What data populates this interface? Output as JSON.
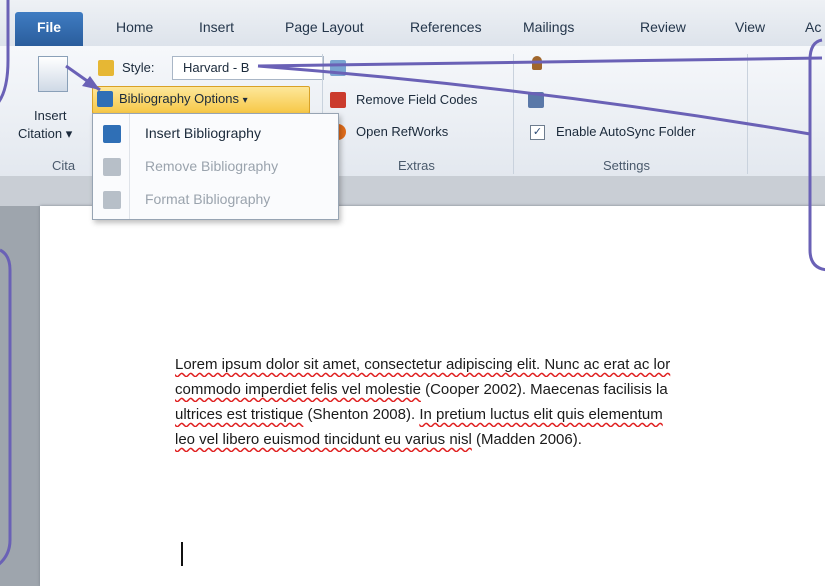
{
  "tabs": [
    {
      "label": "File"
    },
    {
      "label": "Home"
    },
    {
      "label": "Insert"
    },
    {
      "label": "Page Layout"
    },
    {
      "label": "References"
    },
    {
      "label": "Mailings"
    },
    {
      "label": "Review"
    },
    {
      "label": "View"
    },
    {
      "label": "Ac"
    }
  ],
  "ribbon": {
    "insert_citation_line1": "Insert",
    "insert_citation_line2": "Citation",
    "citations_group": "Cita",
    "style_label": "Style:",
    "style_value": "Harvard - B",
    "bibliography_options": "Bibliography Options",
    "remove_field_codes": "Remove Field Codes",
    "open_refworks": "Open RefWorks",
    "extras_group": "Extras",
    "enable_autosync": "Enable AutoSync Folder",
    "settings_group": "Settings"
  },
  "menu": {
    "items": [
      {
        "label": "Insert Bibliography",
        "enabled": true
      },
      {
        "label": "Remove Bibliography",
        "enabled": false
      },
      {
        "label": "Format Bibliography",
        "enabled": false
      }
    ]
  },
  "document": {
    "line1_a": "Lorem ipsum dolor sit amet, consectetur adipiscing elit. Nunc ac erat ac lor",
    "line2_a": "commodo imperdiet felis vel molestie",
    "line2_b": " (Cooper 2002). Maecenas facilisis la",
    "line3_a": "ultrices est tristique",
    "line3_b": " (Shenton 2008). ",
    "line3_c": "In pretium luctus elit quis elementum",
    "line4_a": "leo vel libero euismod tincidunt eu varius nisl",
    "line4_b": " (Madden 2006)."
  },
  "colors": {
    "file_tab": "#2a5d9c",
    "highlight": "#f7c847",
    "callout": "#6a61b6"
  }
}
